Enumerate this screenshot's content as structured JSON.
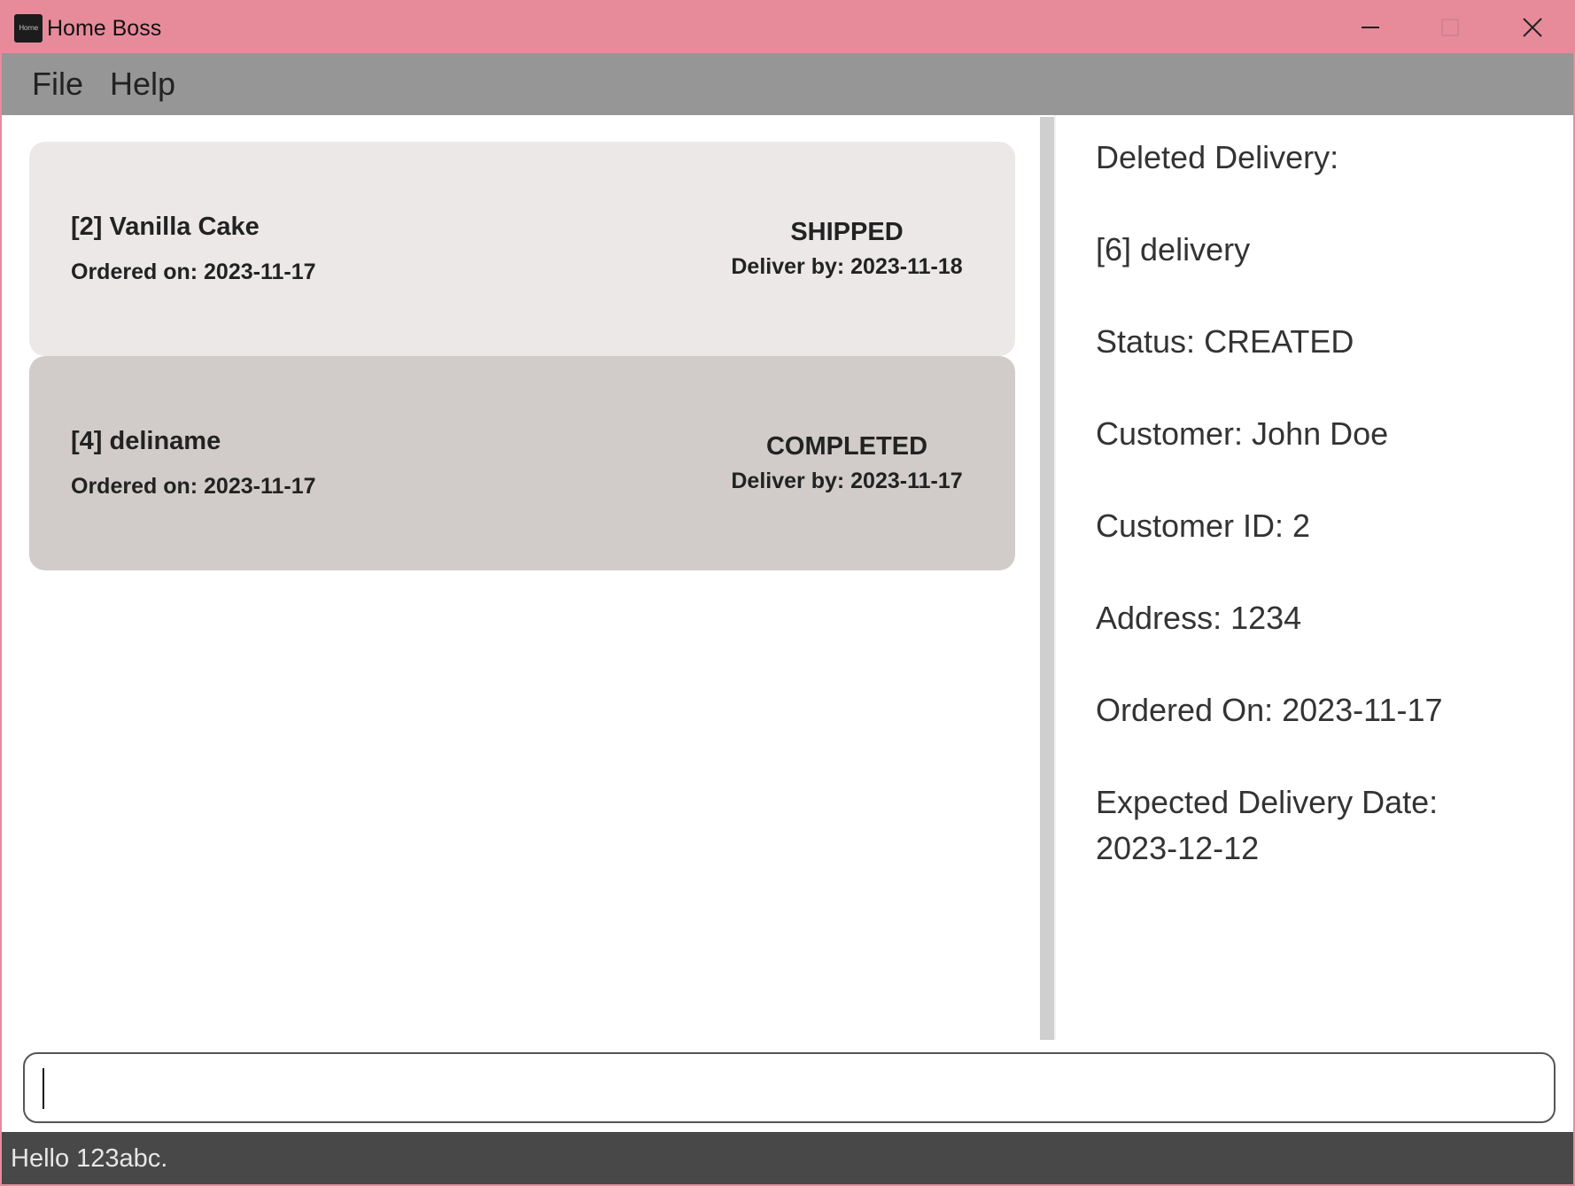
{
  "window": {
    "title": "Home Boss",
    "icon_label": "Home"
  },
  "menu": {
    "items": [
      {
        "label": "File"
      },
      {
        "label": "Help"
      }
    ]
  },
  "deliveries": [
    {
      "name": "[2] Vanilla Cake",
      "ordered": "Ordered on: 2023-11-17",
      "status": "SHIPPED",
      "deliver_by": "Deliver by: 2023-11-18"
    },
    {
      "name": "[4] deliname",
      "ordered": "Ordered on: 2023-11-17",
      "status": "COMPLETED",
      "deliver_by": "Deliver by: 2023-11-17"
    }
  ],
  "result": {
    "lines": [
      "Deleted Delivery:",
      "[6] delivery",
      "Status: CREATED",
      "Customer: John Doe",
      "Customer ID: 2",
      "Address: 1234",
      "Ordered On: 2023-11-17",
      "Expected Delivery Date:",
      "2023-12-12"
    ]
  },
  "command": {
    "value": "",
    "placeholder": ""
  },
  "status_bar": {
    "message": "Hello 123abc."
  },
  "colors": {
    "titlebar": "#e78b9b",
    "menubar": "#969696",
    "card_1": "#ece8e8",
    "card_2": "#d1ccc9",
    "statusbar": "#484848"
  }
}
